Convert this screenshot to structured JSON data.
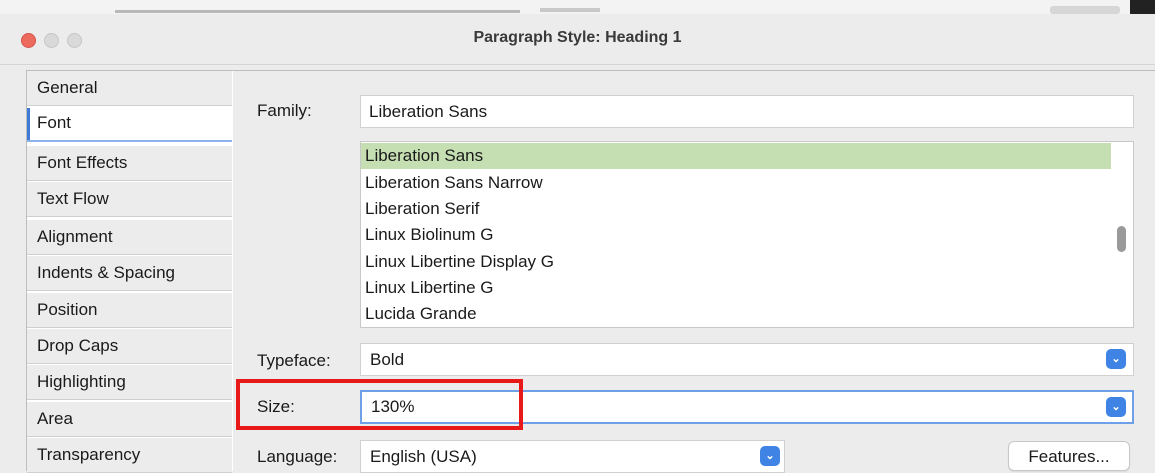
{
  "window": {
    "title": "Paragraph Style: Heading 1"
  },
  "sidebar": {
    "tabs": [
      {
        "label": "General"
      },
      {
        "label": "Font",
        "active": true
      },
      {
        "label": "Font Effects"
      },
      {
        "label": "Text Flow"
      },
      {
        "label": "Alignment"
      },
      {
        "label": "Indents & Spacing"
      },
      {
        "label": "Position"
      },
      {
        "label": "Drop Caps"
      },
      {
        "label": "Highlighting"
      },
      {
        "label": "Area"
      },
      {
        "label": "Transparency"
      }
    ]
  },
  "font": {
    "family_label": "Family:",
    "family_value": "Liberation Sans",
    "family_list": [
      "Liberation Sans",
      "Liberation Sans Narrow",
      "Liberation Serif",
      "Linux Biolinum G",
      "Linux Libertine Display G",
      "Linux Libertine G",
      "Lucida Grande"
    ],
    "selected_family": "Liberation Sans",
    "typeface_label": "Typeface:",
    "typeface_value": "Bold",
    "size_label": "Size:",
    "size_value": "130%",
    "language_label": "Language:",
    "language_value": "English (USA)",
    "features_button": "Features..."
  },
  "colors": {
    "selection": "#c5dfb3",
    "accent": "#3f84e5",
    "highlight_box": "#e81919"
  }
}
